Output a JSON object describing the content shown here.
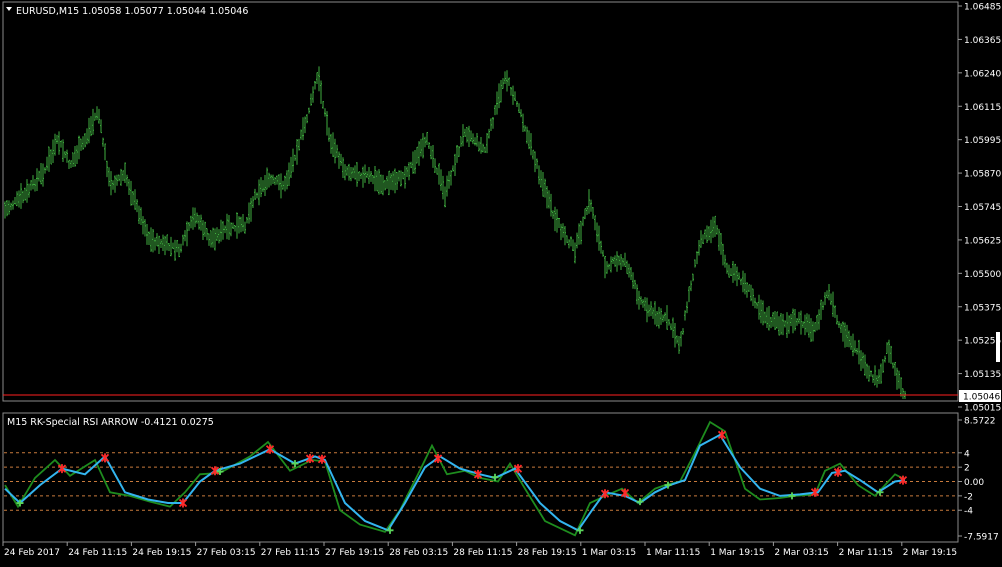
{
  "main_chart": {
    "title": "EURUSD,M15  1.05058 1.05077 1.05044 1.05046",
    "symbol": "EURUSD",
    "timeframe": "M15",
    "ohlc": {
      "open": "1.05058",
      "high": "1.05077",
      "low": "1.05044",
      "close": "1.05046"
    },
    "current_price_label": "1.05046",
    "price_ticks": [
      "1.06485",
      "1.06365",
      "1.06240",
      "1.06115",
      "1.05995",
      "1.05870",
      "1.05745",
      "1.05625",
      "1.05500",
      "1.05375",
      "1.05255",
      "1.05135",
      "1.05015"
    ],
    "bar_color": "#3fae3f",
    "bid_line_color": "#ff2020",
    "price_label_bg": "#ffffff"
  },
  "indicator": {
    "title": "M15 RK-Special RSI ARROW -0.4121 0.0275",
    "name": "RK-Special RSI ARROW",
    "values": [
      "-0.4121",
      "0.0275"
    ],
    "axis_ticks": [
      "8.5722",
      "4",
      "2",
      "0.00",
      "-2",
      "-4",
      "-7.5917"
    ],
    "level_lines": [
      4,
      2,
      0,
      -2,
      -4
    ],
    "range": [
      -7.5917,
      8.5722
    ],
    "fast_line_color": "#33b5f0",
    "slow_line_color": "#1e8c1e",
    "arrow_color": "#ff2a2a",
    "level_color": "#c87a3c"
  },
  "time_axis": {
    "labels": [
      "24 Feb 2017",
      "24 Feb 11:15",
      "24 Feb 19:15",
      "27 Feb 03:15",
      "27 Feb 11:15",
      "27 Feb 19:15",
      "28 Feb 03:15",
      "28 Feb 11:15",
      "28 Feb 19:15",
      "1 Mar 03:15",
      "1 Mar 11:15",
      "1 Mar 19:15",
      "2 Mar 03:15",
      "2 Mar 11:15",
      "2 Mar 19:15"
    ]
  },
  "chart_data": {
    "type": "line",
    "title": "EURUSD,M15  1.05058 1.05077 1.05044 1.05046",
    "x": [
      "24 Feb 2017",
      "24 Feb 11:15",
      "24 Feb 19:15",
      "27 Feb 03:15",
      "27 Feb 11:15",
      "27 Feb 19:15",
      "28 Feb 03:15",
      "28 Feb 11:15",
      "28 Feb 19:15",
      "1 Mar 03:15",
      "1 Mar 11:15",
      "1 Mar 19:15",
      "2 Mar 03:15",
      "2 Mar 11:15",
      "2 Mar 19:15"
    ],
    "series": [
      {
        "values": [
          1.0575,
          1.06,
          1.056,
          1.0572,
          1.059,
          1.0588,
          1.0592,
          1.0595,
          1.06,
          1.0545,
          1.0538,
          1.0565,
          1.0525,
          1.054,
          1.0505
        ]
      }
    ],
    "ylim": [
      1.05,
      1.0649
    ],
    "grid": false
  }
}
